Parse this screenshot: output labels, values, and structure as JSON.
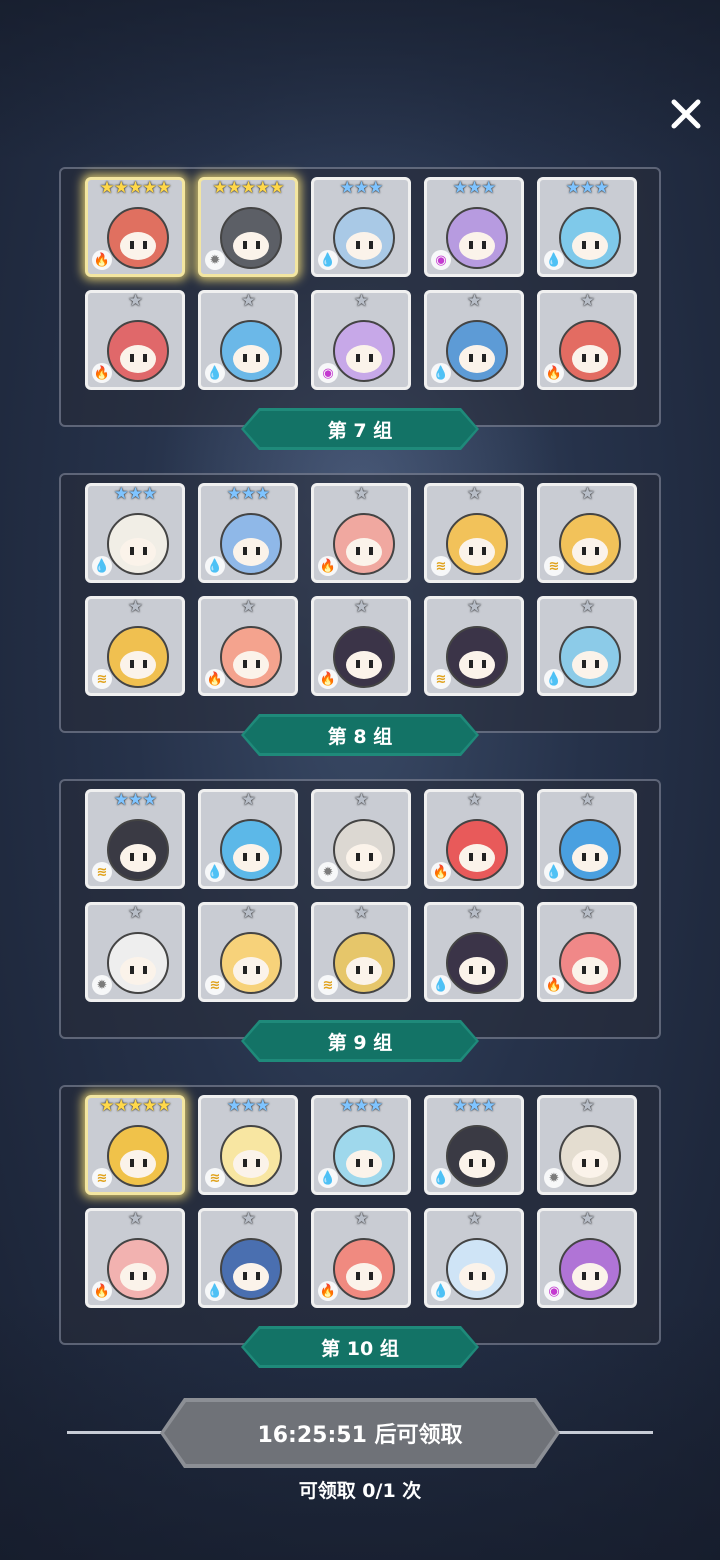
{
  "close_icon": "close-icon",
  "groups": [
    {
      "label": "第 7 组",
      "items": [
        {
          "stars": "★★★★★",
          "tier": "s5",
          "element": "fire",
          "element_glyph": "🔥",
          "color": "#e07060",
          "gold": true
        },
        {
          "stars": "★★★★★",
          "tier": "s5",
          "element": "light",
          "element_glyph": "✹",
          "color": "#5c5f66",
          "gold": true
        },
        {
          "stars": "★★★",
          "tier": "s3",
          "element": "water",
          "element_glyph": "💧",
          "color": "#a9c9e6",
          "gold": false
        },
        {
          "stars": "★★★",
          "tier": "s3",
          "element": "dark",
          "element_glyph": "◉",
          "color": "#b79be0",
          "gold": false
        },
        {
          "stars": "★★★",
          "tier": "s3",
          "element": "water",
          "element_glyph": "💧",
          "color": "#7fc9ea",
          "gold": false
        },
        {
          "stars": "★",
          "tier": "s1",
          "element": "fire",
          "element_glyph": "🔥",
          "color": "#e0686a",
          "gold": false
        },
        {
          "stars": "★",
          "tier": "s1",
          "element": "water",
          "element_glyph": "💧",
          "color": "#6bb8e8",
          "gold": false
        },
        {
          "stars": "★",
          "tier": "s1",
          "element": "dark",
          "element_glyph": "◉",
          "color": "#c7a8e8",
          "gold": false
        },
        {
          "stars": "★",
          "tier": "s1",
          "element": "water",
          "element_glyph": "💧",
          "color": "#5d9bd6",
          "gold": false
        },
        {
          "stars": "★",
          "tier": "s1",
          "element": "fire",
          "element_glyph": "🔥",
          "color": "#e36c62",
          "gold": false
        }
      ]
    },
    {
      "label": "第 8 组",
      "items": [
        {
          "stars": "★★★",
          "tier": "s3",
          "element": "water",
          "element_glyph": "💧",
          "color": "#f1eee6",
          "gold": false
        },
        {
          "stars": "★★★",
          "tier": "s3",
          "element": "water",
          "element_glyph": "💧",
          "color": "#8fb8e8",
          "gold": false
        },
        {
          "stars": "★",
          "tier": "s1",
          "element": "fire",
          "element_glyph": "🔥",
          "color": "#f0a8a0",
          "gold": false
        },
        {
          "stars": "★",
          "tier": "s1",
          "element": "wind",
          "element_glyph": "≋",
          "color": "#f2c25a",
          "gold": false
        },
        {
          "stars": "★",
          "tier": "s1",
          "element": "wind",
          "element_glyph": "≋",
          "color": "#f2c25a",
          "gold": false
        },
        {
          "stars": "★",
          "tier": "s1",
          "element": "wind",
          "element_glyph": "≋",
          "color": "#f0c050",
          "gold": false
        },
        {
          "stars": "★",
          "tier": "s1",
          "element": "fire",
          "element_glyph": "🔥",
          "color": "#f4a38e",
          "gold": false
        },
        {
          "stars": "★",
          "tier": "s1",
          "element": "fire",
          "element_glyph": "🔥",
          "color": "#3b3448",
          "gold": false
        },
        {
          "stars": "★",
          "tier": "s1",
          "element": "wind",
          "element_glyph": "≋",
          "color": "#3b3448",
          "gold": false
        },
        {
          "stars": "★",
          "tier": "s1",
          "element": "water",
          "element_glyph": "💧",
          "color": "#8ccbe8",
          "gold": false
        }
      ]
    },
    {
      "label": "第 9 组",
      "items": [
        {
          "stars": "★★★",
          "tier": "s3",
          "element": "wind",
          "element_glyph": "≋",
          "color": "#3a3a44",
          "gold": false
        },
        {
          "stars": "★",
          "tier": "s1",
          "element": "water",
          "element_glyph": "💧",
          "color": "#5cb8e8",
          "gold": false
        },
        {
          "stars": "★",
          "tier": "s1",
          "element": "light",
          "element_glyph": "✹",
          "color": "#dcd8d2",
          "gold": false
        },
        {
          "stars": "★",
          "tier": "s1",
          "element": "fire",
          "element_glyph": "🔥",
          "color": "#e85a5a",
          "gold": false
        },
        {
          "stars": "★",
          "tier": "s1",
          "element": "water",
          "element_glyph": "💧",
          "color": "#4aa0e0",
          "gold": false
        },
        {
          "stars": "★",
          "tier": "s1",
          "element": "light",
          "element_glyph": "✹",
          "color": "#eeeeee",
          "gold": false
        },
        {
          "stars": "★",
          "tier": "s1",
          "element": "wind",
          "element_glyph": "≋",
          "color": "#f7d27a",
          "gold": false
        },
        {
          "stars": "★",
          "tier": "s1",
          "element": "wind",
          "element_glyph": "≋",
          "color": "#e6c66a",
          "gold": false
        },
        {
          "stars": "★",
          "tier": "s1",
          "element": "water",
          "element_glyph": "💧",
          "color": "#3b3448",
          "gold": false
        },
        {
          "stars": "★",
          "tier": "s1",
          "element": "fire",
          "element_glyph": "🔥",
          "color": "#f08888",
          "gold": false
        }
      ]
    },
    {
      "label": "第 10 组",
      "items": [
        {
          "stars": "★★★★★",
          "tier": "s5",
          "element": "wind",
          "element_glyph": "≋",
          "color": "#f0c24a",
          "gold": true
        },
        {
          "stars": "★★★",
          "tier": "s3",
          "element": "wind",
          "element_glyph": "≋",
          "color": "#f8e6a2",
          "gold": false
        },
        {
          "stars": "★★★",
          "tier": "s3",
          "element": "water",
          "element_glyph": "💧",
          "color": "#9fd8ec",
          "gold": false
        },
        {
          "stars": "★★★",
          "tier": "s3",
          "element": "water",
          "element_glyph": "💧",
          "color": "#3a3a44",
          "gold": false
        },
        {
          "stars": "★",
          "tier": "s1",
          "element": "light",
          "element_glyph": "✹",
          "color": "#e4ddd0",
          "gold": false
        },
        {
          "stars": "★",
          "tier": "s1",
          "element": "fire",
          "element_glyph": "🔥",
          "color": "#f2b2b0",
          "gold": false
        },
        {
          "stars": "★",
          "tier": "s1",
          "element": "water",
          "element_glyph": "💧",
          "color": "#4a6fb0",
          "gold": false
        },
        {
          "stars": "★",
          "tier": "s1",
          "element": "fire",
          "element_glyph": "🔥",
          "color": "#f08a80",
          "gold": false
        },
        {
          "stars": "★",
          "tier": "s1",
          "element": "water",
          "element_glyph": "💧",
          "color": "#cfe4f6",
          "gold": false
        },
        {
          "stars": "★",
          "tier": "s1",
          "element": "dark",
          "element_glyph": "◉",
          "color": "#b074d6",
          "gold": false
        }
      ]
    }
  ],
  "claim": {
    "button_label": "16:25:51 后可领取",
    "count_text": "可领取 0/1 次"
  },
  "colors": {
    "group_label_bg": "#137366",
    "button_bg": "#6f7278",
    "star_gold": "#ffd84a",
    "star_blue": "#7fc4ff",
    "star_silver": "#b8bec8"
  }
}
